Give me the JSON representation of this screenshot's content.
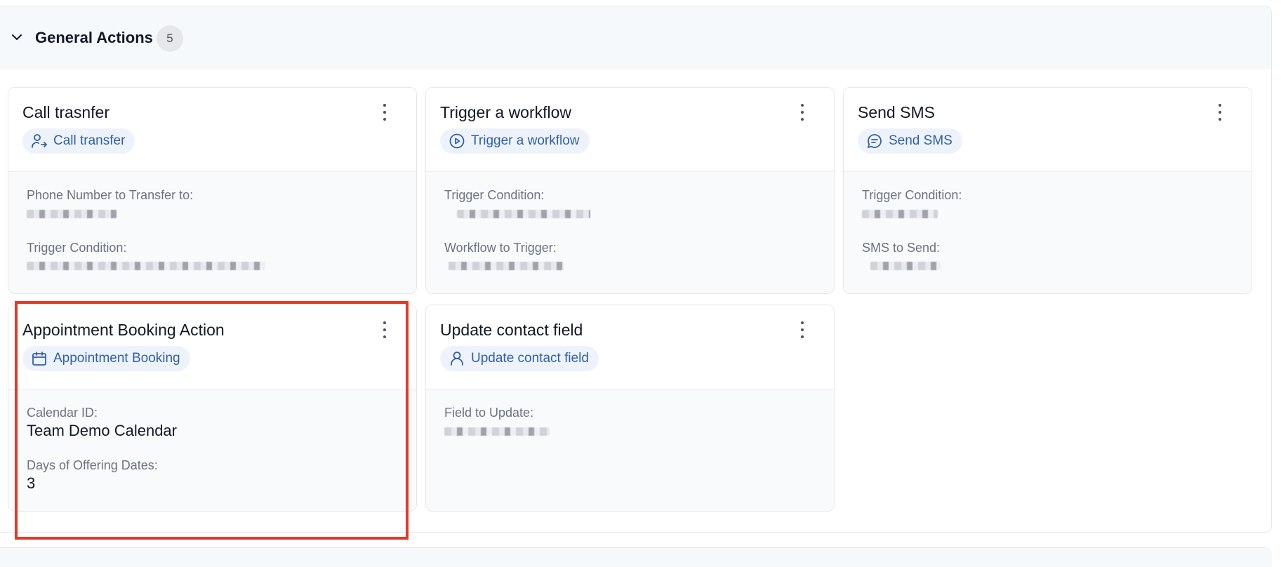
{
  "section": {
    "title": "General Actions",
    "count": "5"
  },
  "cards": [
    {
      "title": "Call trasnfer",
      "tag": "Call transfer",
      "tag_icon": "user-transfer-icon",
      "fields": [
        {
          "label": "Phone Number to Transfer to:",
          "value": ""
        },
        {
          "label": "Trigger Condition:",
          "value": ""
        }
      ]
    },
    {
      "title": "Trigger a workflow",
      "tag": "Trigger a workflow",
      "tag_icon": "play-circle-icon",
      "fields": [
        {
          "label": "Trigger Condition:",
          "value": ""
        },
        {
          "label": "Workflow to Trigger:",
          "value": ""
        }
      ]
    },
    {
      "title": "Send SMS",
      "tag": "Send SMS",
      "tag_icon": "message-icon",
      "fields": [
        {
          "label": "Trigger Condition:",
          "value": ""
        },
        {
          "label": "SMS to Send:",
          "value": ""
        }
      ]
    },
    {
      "title": "Appointment Booking Action",
      "tag": "Appointment Booking",
      "tag_icon": "calendar-icon",
      "fields": [
        {
          "label": "Calendar ID:",
          "value": "Team Demo Calendar"
        },
        {
          "label": "Days of Offering Dates:",
          "value": "3"
        }
      ]
    },
    {
      "title": "Update contact field",
      "tag": "Update contact field",
      "tag_icon": "user-icon",
      "fields": [
        {
          "label": "Field to Update:",
          "value": ""
        }
      ]
    }
  ],
  "colors": {
    "accent": "#2f5fa8",
    "tag_bg": "#eef3fb",
    "highlight": "#e33a27"
  }
}
